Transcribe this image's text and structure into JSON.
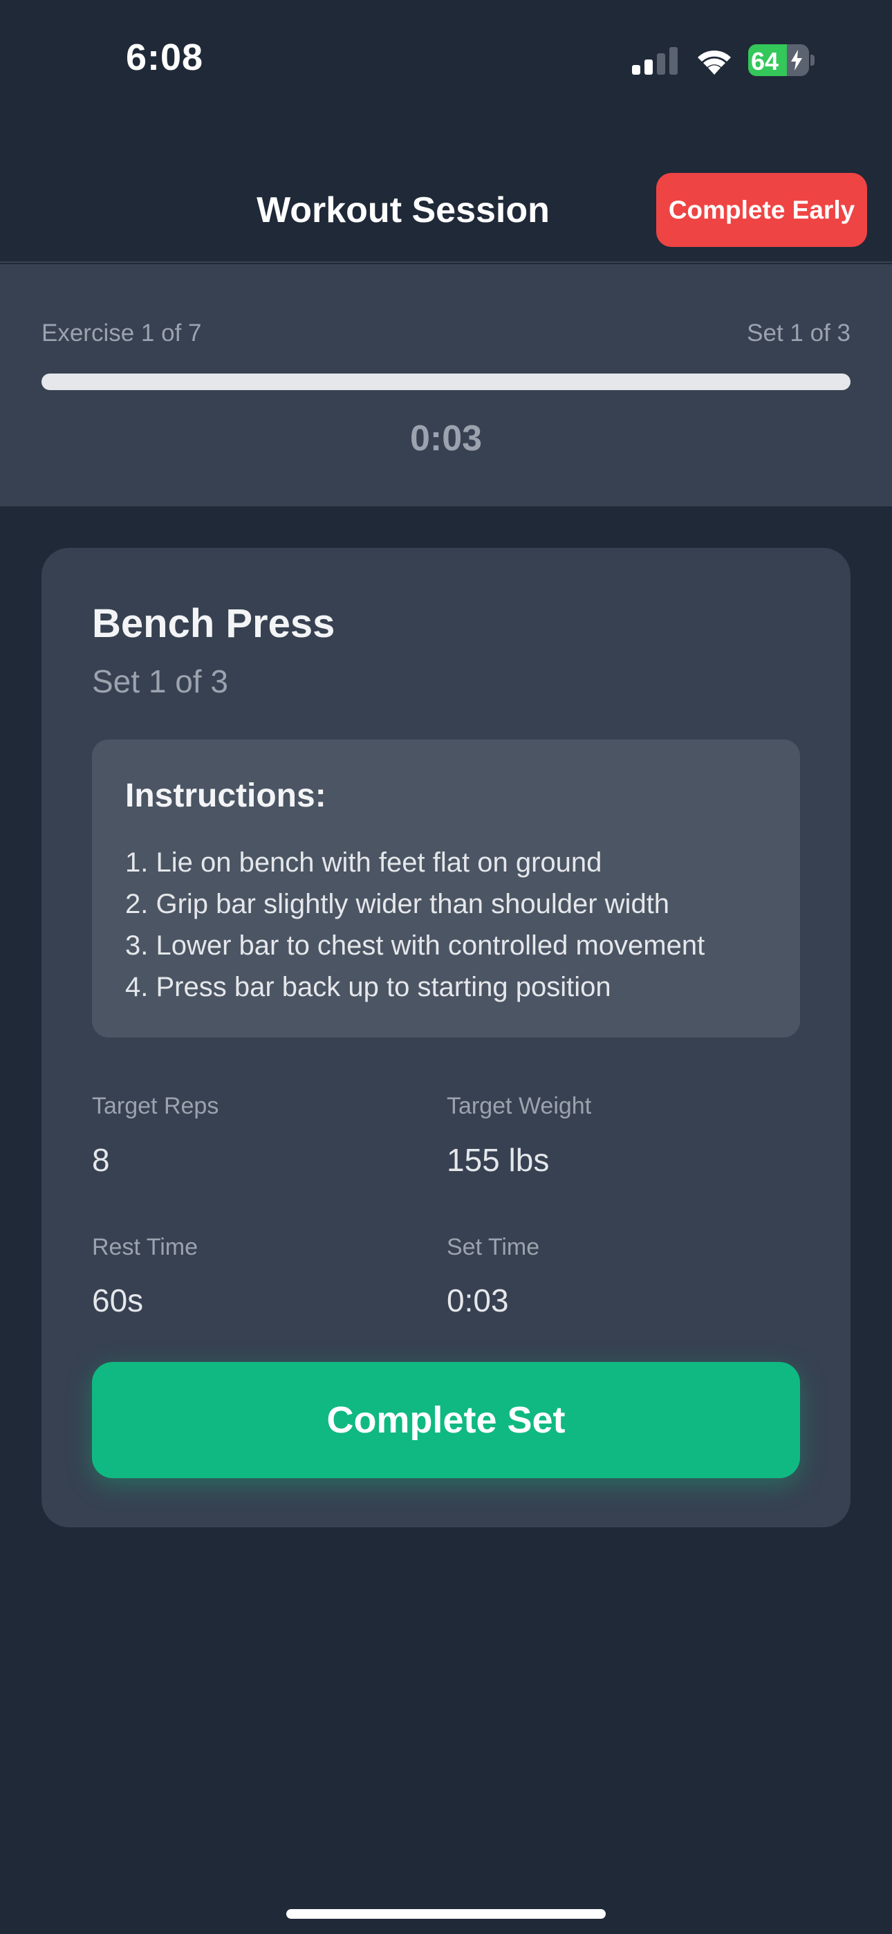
{
  "status_bar": {
    "time": "6:08",
    "battery_level": "64",
    "icons": [
      "signal-icon",
      "wifi-icon",
      "battery-icon",
      "charging-bolt-icon"
    ]
  },
  "header": {
    "title": "Workout Session",
    "complete_early_label": "Complete Early"
  },
  "progress": {
    "exercise_label": "Exercise 1 of 7",
    "set_label": "Set 1 of 3",
    "fraction_complete": 1.0,
    "elapsed": "0:03"
  },
  "exercise": {
    "name": "Bench Press",
    "set": "Set 1 of 3",
    "instructions_title": "Instructions:",
    "instructions": [
      "1. Lie on bench with feet flat on ground",
      "2. Grip bar slightly wider than shoulder width",
      "3. Lower bar to chest with controlled movement",
      "4. Press bar back up to starting position"
    ],
    "stats": {
      "target_reps_label": "Target Reps",
      "target_reps": "8",
      "target_weight_label": "Target Weight",
      "target_weight": "155 lbs",
      "rest_time_label": "Rest Time",
      "rest_time": "60s",
      "set_time_label": "Set Time",
      "set_time": "0:03"
    },
    "complete_set_label": "Complete Set"
  },
  "colors": {
    "background": "#202938",
    "panel": "#374151",
    "danger": "#ef4444",
    "success": "#10b981",
    "battery": "#34c759"
  }
}
